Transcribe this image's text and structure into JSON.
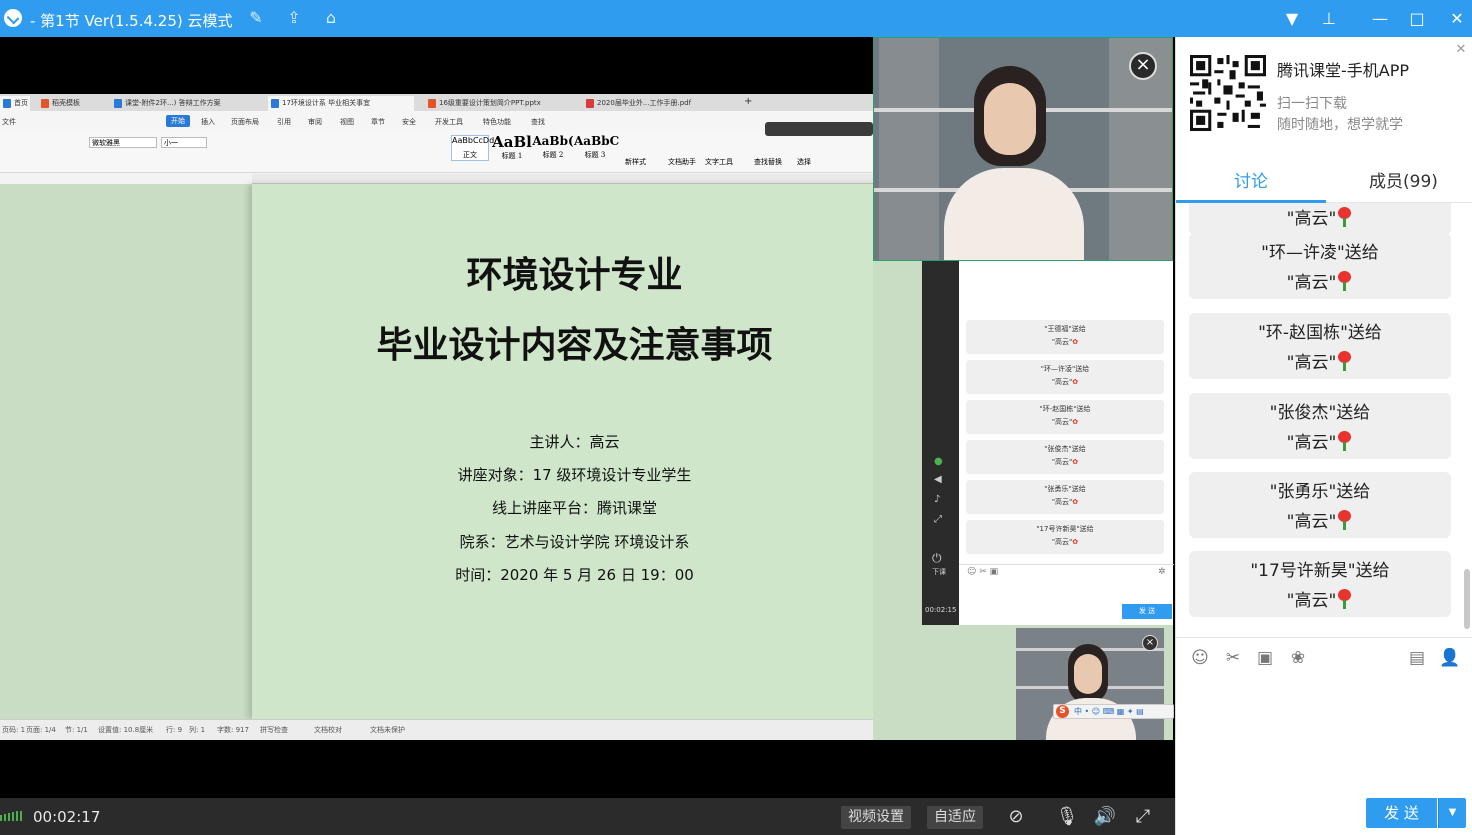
{
  "window": {
    "title": "- 第1节 Ver(1.5.4.25)  云模式"
  },
  "titlebar_icons": [
    "edit-icon",
    "share-icon",
    "home-icon"
  ],
  "window_controls": [
    "dropdown-icon",
    "pin-icon",
    "minimize-icon",
    "maximize-icon",
    "close-icon"
  ],
  "wps": {
    "tabs": [
      "首页",
      "稻壳模板",
      "课堂-附件2环...)  答辩工作方案",
      "17环境设计系  毕业相关事宜",
      "16级重要设计策划简介PPT.pptx",
      "2020届毕业外...工作手册.pdf"
    ],
    "menu": [
      "文件",
      "开始",
      "插入",
      "页面布局",
      "引用",
      "审阅",
      "视图",
      "章节",
      "安全",
      "开发工具",
      "特色功能",
      "查找"
    ],
    "font_name": "微软雅黑",
    "font_size": "小一",
    "styles": [
      "AaBbCcDd",
      "AaBl",
      "AaBb(",
      "AaBbC"
    ],
    "style_names": [
      "正文",
      "标题 1",
      "标题 2",
      "标题 3"
    ],
    "tools": [
      "新样式",
      "文档助手",
      "文字工具",
      "查找替换",
      "选择"
    ],
    "status": [
      "页码: 1",
      "页面: 1/4",
      "节: 1/1",
      "设置值: 10.8厘米",
      "行: 9",
      "列: 1",
      "字数: 917",
      "拼写检查",
      "文档校对",
      "文档未保护"
    ]
  },
  "slide": {
    "title1": "环境设计专业",
    "title2": "毕业设计内容及注意事项",
    "lines": [
      "主讲人：高云",
      "讲座对象：17 级环境设计专业学生",
      "线上讲座平台：腾讯课堂",
      "院系：艺术与设计学院  环境设计系",
      "时间：2020 年 5 月 26 日    19：00"
    ]
  },
  "mini_chat": {
    "messages": [
      {
        "from": "\"王德福\"送给",
        "to": "\"高云\""
      },
      {
        "from": "\"环—许凌\"送给",
        "to": "\"高云\""
      },
      {
        "from": "\"环-赵国栋\"送给",
        "to": "\"高云\""
      },
      {
        "from": "\"张俊杰\"送给",
        "to": "\"高云\""
      },
      {
        "from": "\"张勇乐\"送给",
        "to": "\"高云\""
      },
      {
        "from": "\"17号许新昊\"送给",
        "to": "\"高云\""
      }
    ],
    "send": "发 送",
    "timer": "00:02:15",
    "side_labels": [
      "下课"
    ]
  },
  "bottom": {
    "time": "00:02:17",
    "video_settings": "视频设置",
    "adaptive": "自适应"
  },
  "panel": {
    "app_title": "腾讯课堂-手机APP",
    "sub1": "扫一扫下载",
    "sub2": "随时随地，想学就学",
    "tab_discuss": "讨论",
    "tab_members": "成员(99)",
    "partial_top": "\"高云\"",
    "messages": [
      {
        "from": "\"环—许凌\"送给",
        "to": "\"高云\""
      },
      {
        "from": "\"环-赵国栋\"送给",
        "to": "\"高云\""
      },
      {
        "from": "\"张俊杰\"送给",
        "to": "\"高云\""
      },
      {
        "from": "\"张勇乐\"送给",
        "to": "\"高云\""
      },
      {
        "from": "\"17号许新昊\"送给",
        "to": "\"高云\""
      }
    ],
    "send": "发 送"
  },
  "colors": {
    "accent": "#2f9cf0",
    "rose": "#e8342e",
    "page_green": "#cfe6ca"
  }
}
